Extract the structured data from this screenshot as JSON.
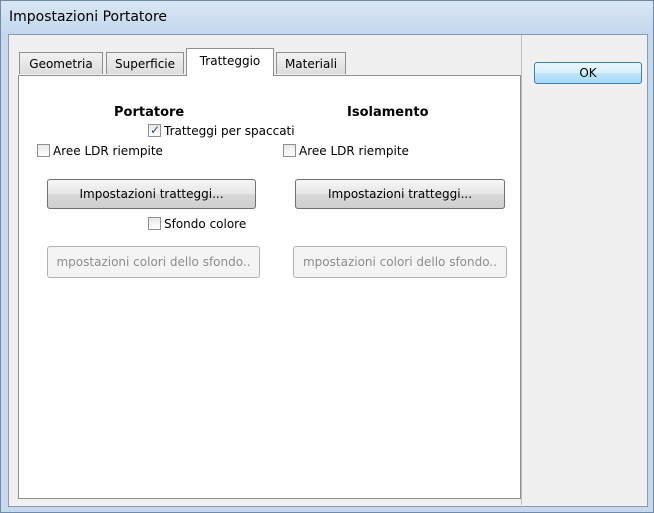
{
  "window": {
    "title": "Impostazioni Portatore"
  },
  "tabs": [
    {
      "label": "Geometria",
      "active": false
    },
    {
      "label": "Superficie",
      "active": false
    },
    {
      "label": "Tratteggio",
      "active": true
    },
    {
      "label": "Materiali",
      "active": false
    }
  ],
  "ok_button": {
    "label": "OK"
  },
  "panel": {
    "portatore": {
      "heading": "Portatore",
      "aree_checkbox": {
        "label": "Aree LDR riempite",
        "checked": false
      },
      "tratteggi_button": "Impostazioni tratteggi...",
      "colori_button": "mpostazioni colori dello sfondo.."
    },
    "isolamento": {
      "heading": "Isolamento",
      "aree_checkbox": {
        "label": "Aree LDR riempite",
        "checked": false
      },
      "tratteggi_button": "Impostazioni tratteggi...",
      "colori_button": "mpostazioni colori dello sfondo.."
    },
    "tratteggi_spaccati": {
      "label": "Tratteggi per spaccati",
      "checked": true
    },
    "sfondo_colore": {
      "label": "Sfondo colore",
      "checked": false
    }
  }
}
